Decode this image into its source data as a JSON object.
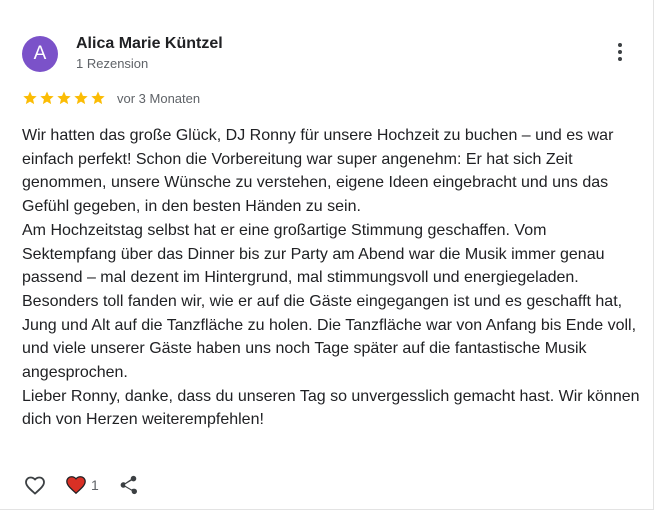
{
  "review": {
    "avatar_letter": "A",
    "author": "Alica Marie Küntzel",
    "review_count": "1 Rezension",
    "rating": 5,
    "rating_max": 5,
    "date": "vor 3 Monaten",
    "paragraphs": [
      "Wir hatten das große Glück, DJ Ronny für unsere Hochzeit zu buchen – und es war einfach perfekt! Schon die Vorbereitung war super angenehm: Er hat sich Zeit genommen, unsere Wünsche zu verstehen, eigene Ideen eingebracht und uns das Gefühl gegeben, in den besten Händen zu sein.",
      "Am Hochzeitstag selbst hat er eine großartige Stimmung geschaffen. Vom Sektempfang über das Dinner bis zur Party am Abend war die Musik immer genau passend – mal dezent im Hintergrund, mal stimmungsvoll und energiegeladen. Besonders toll fanden wir, wie er auf die Gäste eingegangen ist und es geschafft hat, Jung und Alt auf die Tanzfläche zu holen. Die Tanzfläche war von Anfang bis Ende voll, und viele unserer Gäste haben uns noch Tage später auf die fantastische Musik angesprochen.",
      "Lieber Ronny, danke, dass du unseren Tag so unvergesslich gemacht hast. Wir können dich von Herzen weiterempfehlen!"
    ],
    "reaction_count": "1"
  },
  "icons": {
    "menu": "more-vert-icon",
    "like": "heart-outline-icon",
    "reaction": "heart-filled-icon",
    "share": "share-icon",
    "star": "star-icon"
  },
  "colors": {
    "avatar": "#7b52c9",
    "star": "#fbbc04",
    "reaction_heart": "#d93025",
    "text": "#202124",
    "secondary_text": "#5f6368"
  }
}
